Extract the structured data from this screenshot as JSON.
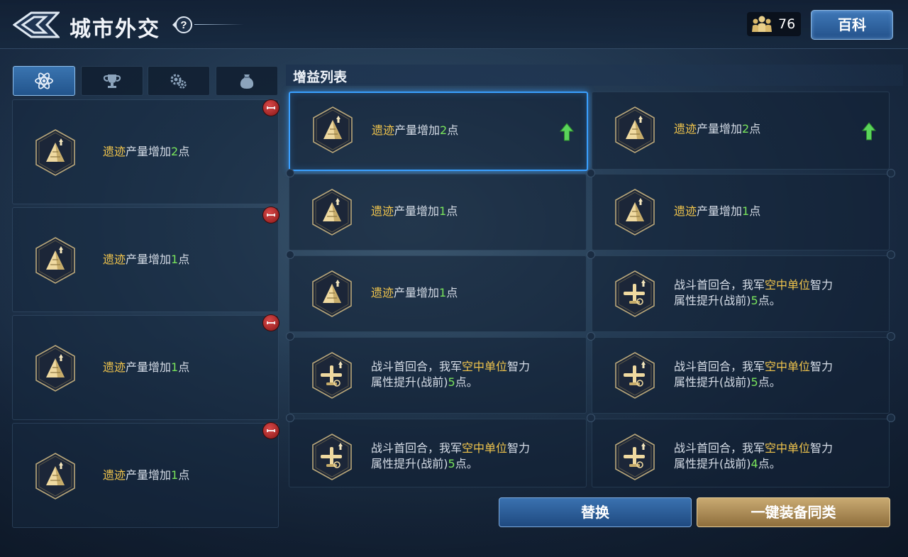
{
  "header": {
    "title": "城市外交",
    "help_icon": "question-icon",
    "population": "76",
    "wiki_label": "百科"
  },
  "tabs": [
    {
      "icon": "atom-icon",
      "active": true
    },
    {
      "icon": "trophy-icon",
      "active": false
    },
    {
      "icon": "gears-icon",
      "active": false
    },
    {
      "icon": "sack-icon",
      "active": false
    }
  ],
  "equipped": [
    {
      "pre": "遗迹",
      "mid": "产量增加",
      "num": "2",
      "post": "点"
    },
    {
      "pre": "遗迹",
      "mid": "产量增加",
      "num": "1",
      "post": "点"
    },
    {
      "pre": "遗迹",
      "mid": "产量增加",
      "num": "1",
      "post": "点"
    },
    {
      "pre": "遗迹",
      "mid": "产量增加",
      "num": "1",
      "post": "点"
    }
  ],
  "list": {
    "title": "增益列表",
    "items": [
      {
        "type": "ruins",
        "pre": "遗迹",
        "mid": "产量增加",
        "num": "2",
        "post": "点",
        "upgrade": true,
        "selected": true
      },
      {
        "type": "ruins",
        "pre": "遗迹",
        "mid": "产量增加",
        "num": "2",
        "post": "点",
        "upgrade": true,
        "selected": false
      },
      {
        "type": "ruins",
        "pre": "遗迹",
        "mid": "产量增加",
        "num": "1",
        "post": "点",
        "upgrade": false,
        "selected": false
      },
      {
        "type": "ruins",
        "pre": "遗迹",
        "mid": "产量增加",
        "num": "1",
        "post": "点",
        "upgrade": false,
        "selected": false
      },
      {
        "type": "ruins",
        "pre": "遗迹",
        "mid": "产量增加",
        "num": "1",
        "post": "点",
        "upgrade": false,
        "selected": false
      },
      {
        "type": "air",
        "l1a": "战斗首回合，我军",
        "l1b": "空中单位",
        "l1c": "智力",
        "l2a": "属性提升(战前)",
        "num": "5",
        "post": "点。"
      },
      {
        "type": "air",
        "l1a": "战斗首回合，我军",
        "l1b": "空中单位",
        "l1c": "智力",
        "l2a": "属性提升(战前)",
        "num": "5",
        "post": "点。"
      },
      {
        "type": "air",
        "l1a": "战斗首回合，我军",
        "l1b": "空中单位",
        "l1c": "智力",
        "l2a": "属性提升(战前)",
        "num": "5",
        "post": "点。"
      },
      {
        "type": "air",
        "l1a": "战斗首回合，我军",
        "l1b": "空中单位",
        "l1c": "智力",
        "l2a": "属性提升(战前)",
        "num": "5",
        "post": "点。"
      },
      {
        "type": "air",
        "l1a": "战斗首回合，我军",
        "l1b": "空中单位",
        "l1c": "智力",
        "l2a": "属性提升(战前)",
        "num": "4",
        "post": "点。"
      }
    ]
  },
  "buttons": {
    "replace": "替换",
    "equip_all": "一键装备同类"
  },
  "colors": {
    "highlight": "#f0c44c",
    "number": "#79e35c",
    "select_border": "#3aa0ff",
    "upgrade_arrow": "#5ad45a"
  }
}
